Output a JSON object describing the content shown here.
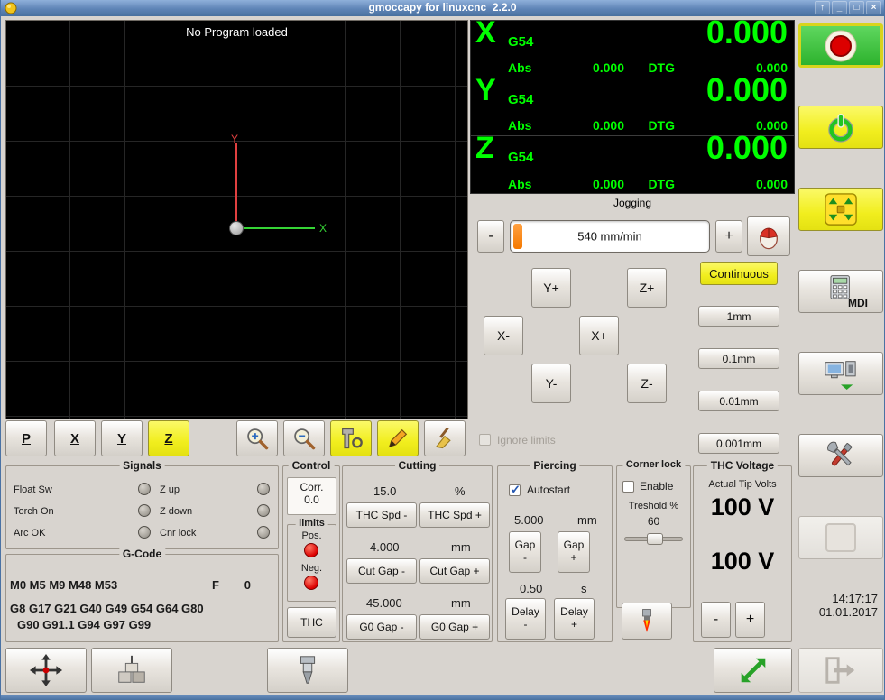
{
  "titlebar": {
    "title": "gmoccapy for linuxcnc  2.2.0",
    "controls": [
      {
        "name": "shade",
        "glyph": "↑"
      },
      {
        "name": "minimize",
        "glyph": "_"
      },
      {
        "name": "maximize",
        "glyph": "□"
      },
      {
        "name": "close",
        "glyph": "×"
      }
    ]
  },
  "preview": {
    "message": "No Program loaded",
    "x_axis_label": "X",
    "y_axis_label": "Y"
  },
  "preview_toolbar": {
    "perspective": "P",
    "view_x": "X",
    "view_y": "Y",
    "view_z": "Z"
  },
  "dro": {
    "axes": [
      {
        "letter": "X",
        "system": "G54",
        "value": "0.000",
        "abs_label": "Abs",
        "abs_value": "0.000",
        "dtg_label": "DTG",
        "dtg_value": "0.000"
      },
      {
        "letter": "Y",
        "system": "G54",
        "value": "0.000",
        "abs_label": "Abs",
        "abs_value": "0.000",
        "dtg_label": "DTG",
        "dtg_value": "0.000"
      },
      {
        "letter": "Z",
        "system": "G54",
        "value": "0.000",
        "abs_label": "Abs",
        "abs_value": "0.000",
        "dtg_label": "DTG",
        "dtg_value": "0.000"
      }
    ]
  },
  "jogging": {
    "title": "Jogging",
    "speed_minus": "-",
    "speed_plus": "+",
    "speed_value": "540 mm/min",
    "continuous": "Continuous",
    "jog_buttons": [
      "Y+",
      "Z+",
      "X-",
      "X+",
      "Y-",
      "Z-"
    ],
    "increments": [
      "1mm",
      "0.1mm",
      "0.01mm",
      "0.001mm"
    ],
    "ignore_limits": "Ignore limits"
  },
  "right_panel": {
    "mdi_label": "MDI",
    "time": "14:17:17",
    "date": "01.01.2017"
  },
  "signals": {
    "title": "Signals",
    "col1": [
      "Float Sw",
      "Torch On",
      "Arc OK"
    ],
    "col2": [
      "Z up",
      "Z down",
      "Cnr lock"
    ]
  },
  "gcode": {
    "title": "G-Code",
    "mcodes": "M0 M5 M9 M48 M53",
    "feed_label": "F",
    "feed_value": "0",
    "gcodes_line1": "G8 G17 G21 G40 G49 G54 G64 G80",
    "gcodes_line2": "G90 G91.1 G94 G97 G99"
  },
  "control": {
    "title": "Control",
    "corr_label": "Corr.",
    "corr_value": "0.0",
    "limits_title": "limits",
    "pos_label": "Pos.",
    "neg_label": "Neg.",
    "thc_button": "THC"
  },
  "cutting": {
    "title": "Cutting",
    "feed_value": "15.0",
    "feed_unit": "%",
    "thc_spd_minus": "THC Spd -",
    "thc_spd_plus": "THC Spd +",
    "cut_gap_value": "4.000",
    "cut_gap_unit": "mm",
    "cut_gap_minus": "Cut Gap -",
    "cut_gap_plus": "Cut Gap +",
    "g0_gap_value": "45.000",
    "g0_gap_unit": "mm",
    "g0_gap_minus": "G0 Gap -",
    "g0_gap_plus": "G0 Gap +"
  },
  "piercing": {
    "title": "Piercing",
    "autostart": "Autostart",
    "height_value": "5.000",
    "height_unit": "mm",
    "gap_label": "Gap",
    "gap_minus": "-",
    "gap_plus": "+",
    "delay_value": "0.50",
    "delay_unit": "s",
    "delay_label": "Delay",
    "delay_minus": "-",
    "delay_plus": "+"
  },
  "corner_lock": {
    "title": "Corner lock",
    "enable": "Enable",
    "threshold_label": "Treshold %",
    "threshold_value": "60"
  },
  "thc_voltage": {
    "title": "THC Voltage",
    "subtitle": "Actual Tip Volts",
    "actual_volts": "100 V",
    "target_volts": "100 V",
    "minus": "-",
    "plus": "+"
  },
  "colors": {
    "accent_yellow": "#f1ee1e",
    "dro_green": "#00ff00",
    "slider_orange": "#f57900",
    "led_red": "#dc0000",
    "estop_green": "#2db22d",
    "titlebar_blue": "#5e84b6"
  }
}
